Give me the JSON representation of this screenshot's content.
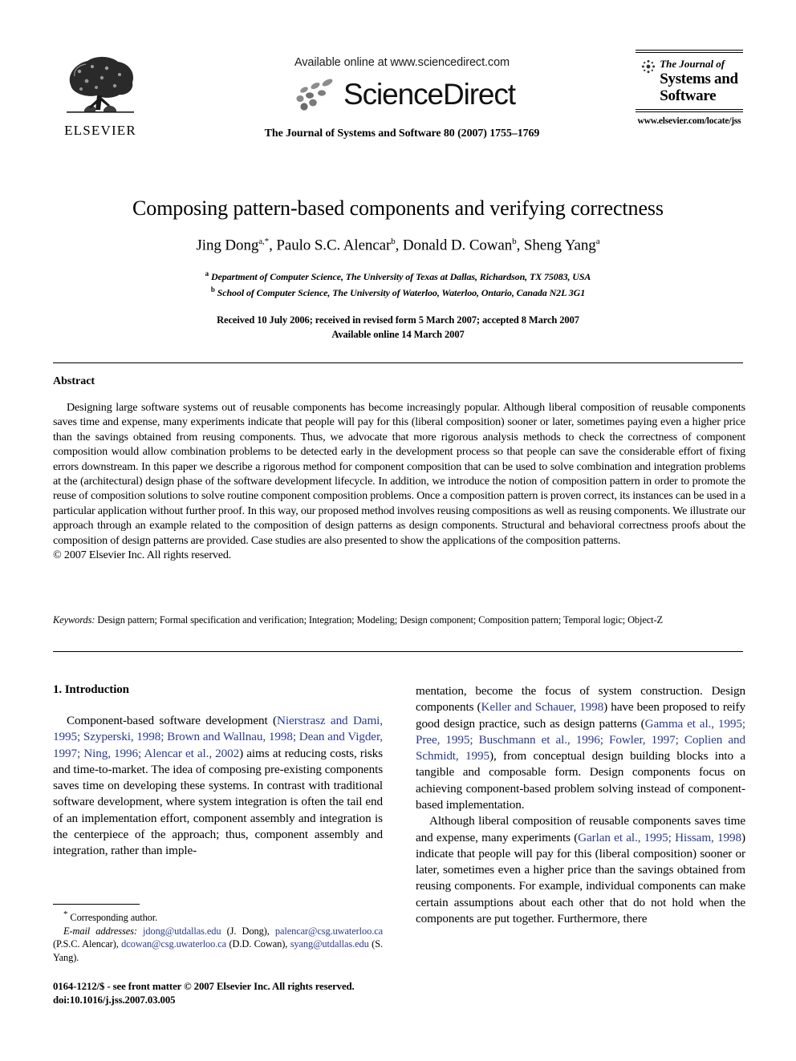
{
  "masthead": {
    "publisher_name": "ELSEVIER",
    "publisher_logo_icon": "elsevier-tree-logo",
    "available_online": "Available online at www.sciencedirect.com",
    "sciencedirect_wordmark": "ScienceDirect",
    "sciencedirect_logo_icon": "sciencedirect-dots-logo",
    "journal_citation": "The Journal of Systems and Software 80 (2007) 1755–1769",
    "journal_box": {
      "logo_icon": "journal-emblem-icon",
      "line1": "The Journal of",
      "line2": "Systems and",
      "line3": "Software",
      "url": "www.elsevier.com/locate/jss"
    }
  },
  "article": {
    "title": "Composing pattern-based components and verifying correctness",
    "authors_prefix": "Jing Dong ",
    "authors": [
      {
        "name": "Jing Dong",
        "marks": "a,*"
      },
      {
        "name": "Paulo S.C. Alencar",
        "marks": "b"
      },
      {
        "name": "Donald D. Cowan",
        "marks": "b"
      },
      {
        "name": "Sheng Yang",
        "marks": "a"
      }
    ],
    "affiliations": [
      {
        "mark": "a",
        "text": "Department of Computer Science, The University of Texas at Dallas, Richardson, TX 75083, USA"
      },
      {
        "mark": "b",
        "text": "School of Computer Science, The University of Waterloo, Waterloo, Ontario, Canada N2L 3G1"
      }
    ],
    "dates_line1": "Received 10 July 2006; received in revised form 5 March 2007; accepted 8 March 2007",
    "dates_line2": "Available online 14 March 2007"
  },
  "abstract": {
    "heading": "Abstract",
    "text": "Designing large software systems out of reusable components has become increasingly popular. Although liberal composition of reusable components saves time and expense, many experiments indicate that people will pay for this (liberal composition) sooner or later, sometimes paying even a higher price than the savings obtained from reusing components. Thus, we advocate that more rigorous analysis methods to check the correctness of component composition would allow combination problems to be detected early in the development process so that people can save the considerable effort of fixing errors downstream. In this paper we describe a rigorous method for component composition that can be used to solve combination and integration problems at the (architectural) design phase of the software development lifecycle. In addition, we introduce the notion of composition pattern in order to promote the reuse of composition solutions to solve routine component composition problems. Once a composition pattern is proven correct, its instances can be used in a particular application without further proof. In this way, our proposed method involves reusing compositions as well as reusing components. We illustrate our approach through an example related to the composition of design patterns as design components. Structural and behavioral correctness proofs about the composition of design patterns are provided. Case studies are also presented to show the applications of the composition patterns.",
    "copyright": "© 2007 Elsevier Inc. All rights reserved."
  },
  "keywords": {
    "label": "Keywords:",
    "text": " Design pattern; Formal specification and verification; Integration; Modeling; Design component; Composition pattern; Temporal logic; Object-Z"
  },
  "body": {
    "section_heading": "1. Introduction",
    "left_column": {
      "par1_seg1": "Component-based software development (",
      "par1_cite1": "Nierstrasz and Dami, 1995; Szyperski, 1998; Brown and Wallnau, 1998; Dean and Vigder, 1997; Ning, 1996; Alencar et al., 2002",
      "par1_seg2": ") aims at reducing costs, risks and time-to-market. The idea of composing pre-existing components saves time on developing these systems. In contrast with traditional software development, where system integration is often the tail end of an implementation effort, component assembly and integration is the centerpiece of the approach; thus, component assembly and integration, rather than imple-"
    },
    "right_column": {
      "par1_seg1": "mentation, become the focus of system construction. Design components (",
      "par1_cite1": "Keller and Schauer, 1998",
      "par1_seg2": ") have been proposed to reify good design practice, such as design patterns (",
      "par1_cite2": "Gamma et al., 1995; Pree, 1995; Buschmann et al., 1996; Fowler, 1997; Coplien and Schmidt, 1995",
      "par1_seg3": "), from conceptual design building blocks into a tangible and composable form. Design components focus on achieving component-based problem solving instead of component-based implementation.",
      "par2_seg1": "Although liberal composition of reusable components saves time and expense, many experiments (",
      "par2_cite1": "Garlan et al., 1995; Hissam, 1998",
      "par2_seg2": ") indicate that people will pay for this (liberal composition) sooner or later, sometimes even a higher price than the savings obtained from reusing components. For example, individual components can make certain assumptions about each other that do not hold when the components are put together. Furthermore, there"
    }
  },
  "footnotes": {
    "corresponding_mark": "*",
    "corresponding_text": " Corresponding author.",
    "email_label": "E-mail addresses:",
    "emails": [
      {
        "address": "jdong@utdallas.edu",
        "owner": "(J. Dong)"
      },
      {
        "address": "palencar@csg.uwaterloo.ca",
        "owner": "(P.S.C. Alencar)"
      },
      {
        "address": "dcowan@csg.uwaterloo.ca",
        "owner": "(D.D. Cowan)"
      },
      {
        "address": "syang@utdallas.edu",
        "owner": "(S. Yang)"
      }
    ]
  },
  "footer": {
    "issn_line": "0164-1212/$ - see front matter © 2007 Elsevier Inc. All rights reserved.",
    "doi_line": "doi:10.1016/j.jss.2007.03.005"
  },
  "colors": {
    "link": "#2b3a8f",
    "text": "#000000",
    "background": "#ffffff"
  }
}
